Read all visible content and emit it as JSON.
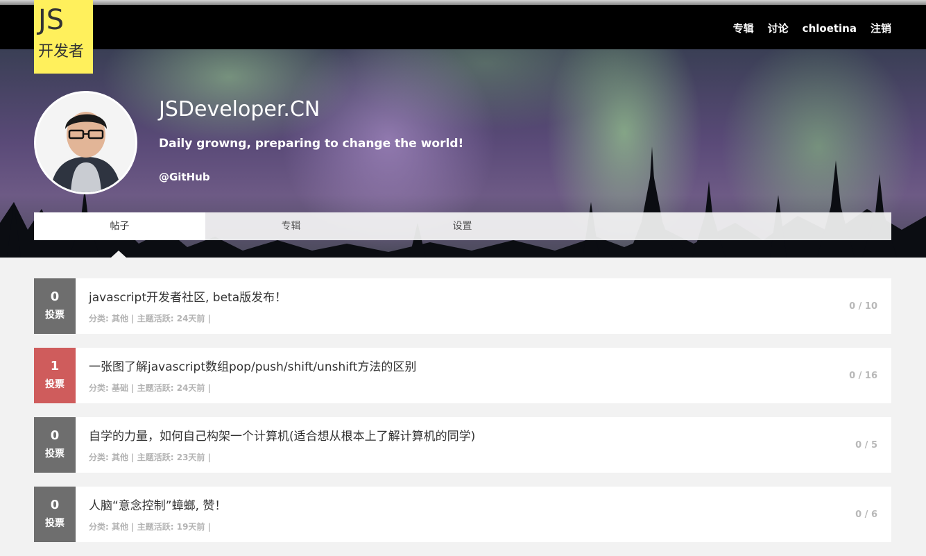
{
  "logo": {
    "js": "JS",
    "cn": "开发者"
  },
  "nav": {
    "items": [
      "专辑",
      "讨论",
      "chloetina",
      "注销"
    ]
  },
  "profile": {
    "name": "JSDeveloper.CN",
    "tagline": "Daily growng, preparing to change the world!",
    "github": "@GitHub"
  },
  "tabs": {
    "items": [
      "帖子",
      "专辑",
      "设置"
    ],
    "active": "帖子"
  },
  "posts": [
    {
      "votes": "0",
      "vote_label": "投票",
      "title": "javascript开发者社区, beta版发布！",
      "category_label": "分类: ",
      "category": "其他",
      "activity": " | 主题活跃: 24天前 |",
      "stats": "0 / 10",
      "highlight": false
    },
    {
      "votes": "1",
      "vote_label": "投票",
      "title": "一张图了解javascript数组pop/push/shift/unshift方法的区别",
      "category_label": "分类: ",
      "category": "基础",
      "activity": " | 主题活跃: 24天前 |",
      "stats": "0 / 16",
      "highlight": true
    },
    {
      "votes": "0",
      "vote_label": "投票",
      "title": "自学的力量，如何自己构架一个计算机(适合想从根本上了解计算机的同学)",
      "category_label": "分类: ",
      "category": "其他",
      "activity": " | 主题活跃: 23天前 |",
      "stats": "0 / 5",
      "highlight": false
    },
    {
      "votes": "0",
      "vote_label": "投票",
      "title": "人脑“意念控制”蟑螂, 赞！",
      "category_label": "分类: ",
      "category": "其他",
      "activity": " | 主题活跃: 19天前 |",
      "stats": "0 / 6",
      "highlight": false
    }
  ],
  "colors": {
    "logo_bg": "#fff05c",
    "vote_default": "#6e6e6e",
    "vote_highlight": "#cf5c5c",
    "topbar": "#000000"
  }
}
